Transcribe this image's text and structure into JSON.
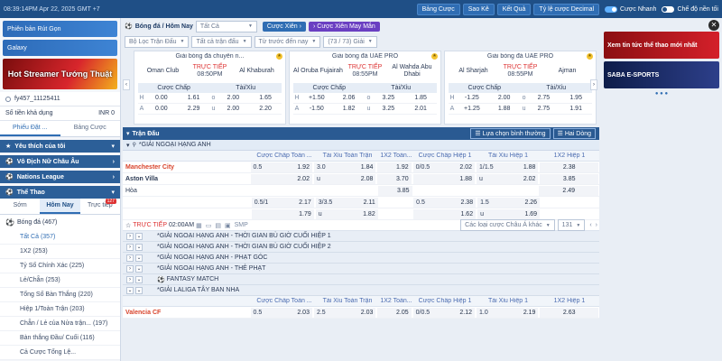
{
  "topbar": {
    "time": "08:39:14PM Apr 22, 2025 GMT +7",
    "buttons": [
      "Bảng Cược",
      "Sao Kê",
      "Kết Quả",
      "Tỷ lệ cược Decimal"
    ],
    "toggle_fast": "Cược Nhanh",
    "toggle_bg": "Chế độ nền tối"
  },
  "sidebar": {
    "promo1": "Phiên bản Rút Gọn",
    "promo2": "Galaxy",
    "banner": "Hot Streamer Tướng Thuật",
    "user": "fy457_11125411",
    "balance_label": "Số tiền khả dụng",
    "balance_value": "INR 0",
    "tabs": [
      "Phiếu Đặt ...",
      "Bảng Cược"
    ],
    "sections": [
      "Yêu thích của tôi",
      "Vô Địch Nữ Châu Âu",
      "Nations League",
      "Thể Thao"
    ],
    "subtabs": [
      "Sớm",
      "Hôm Nay",
      "Trực tiếp"
    ],
    "subtab_count": "127",
    "sport": "Bóng đá",
    "sport_count": "(467)",
    "list": [
      "Tất Cả (357)",
      "1X2 (253)",
      "Tỷ Số Chính Xác (225)",
      "Lẻ/Chẵn (253)",
      "Tổng Số Bàn Thắng (220)",
      "Hiệp 1/Toàn Trận (203)",
      "Chẵn / Lẻ của Nửa trận... (197)",
      "Bàn thắng Đầu/ Cuối (116)",
      "Cả Cược Tổng Lệ..."
    ]
  },
  "filters": {
    "sport_label": "Bóng đá / Hôm Nay",
    "all": "Tất Cả",
    "bet": "Cược Xiên",
    "bet_lucky": "Cược Xiên May Mắn",
    "league_filter": "Bộ Lọc Trận Đấu",
    "all_matches": "Tất cả trận đấu",
    "before": "Từ trước đến nay",
    "count": "(73 / 73) Giải"
  },
  "cards": [
    {
      "league": "Giải bóng đá chuyên n...",
      "home": "Oman Club",
      "away": "Al Khaburah",
      "live": "TRỰC TIẾP",
      "time": "08:50PM",
      "h": [
        "H",
        "0.00",
        "1.61",
        "o",
        "2.00",
        "1.65"
      ],
      "a": [
        "A",
        "0.00",
        "2.29",
        "u",
        "2.00",
        "2.20"
      ]
    },
    {
      "league": "Giải bóng đá UAE PRO",
      "home": "Al Oruba Fujairah",
      "away": "Al Wahda Abu Dhabi",
      "live": "TRỰC TIẾP",
      "time": "08:55PM",
      "h": [
        "H",
        "+1.50",
        "2.06",
        "o",
        "3.25",
        "1.85"
      ],
      "a": [
        "A",
        "-1.50",
        "1.82",
        "u",
        "3.25",
        "2.01"
      ]
    },
    {
      "league": "Giải bóng đá UAE PRO",
      "home": "Al Sharjah",
      "away": "Ajman",
      "live": "TRỰC TIẾP",
      "time": "08:55PM",
      "h": [
        "H",
        "-1.25",
        "2.00",
        "o",
        "2.75",
        "1.95"
      ],
      "a": [
        "A",
        "+1.25",
        "1.88",
        "u",
        "2.75",
        "1.91"
      ]
    }
  ],
  "card_heads": [
    "Cược Chấp",
    "Tài/Xỉu"
  ],
  "table": {
    "title": "Trận Đấu",
    "sort": "Lựa chọn bình thường",
    "lines": "Hai Dòng",
    "league1": "*GIẢI NGOẠI HẠNG ANH",
    "cols": [
      "Cược Chấp Toàn ...",
      "Tài Xỉu Toàn Trận",
      "1X2 Toàn...",
      "Cược Chấp Hiệp 1",
      "Tài Xỉu Hiệp 1",
      "1X2 Hiệp 1"
    ],
    "home": "Manchester City",
    "away": "Aston Villa",
    "draw": "Hòa",
    "row1": [
      "0.5",
      "1.92",
      "3.0",
      "1.84",
      "1.92",
      "0/0.5",
      "2.02",
      "1/1.5",
      "1.88",
      "2.38"
    ],
    "row2": [
      "",
      "2.02",
      "u",
      "2.08",
      "3.70",
      "",
      "1.88",
      "u",
      "2.02",
      "3.85"
    ],
    "row3": [
      "3.85",
      "2.49"
    ],
    "row4": [
      "0.5/1",
      "2.17",
      "3/3.5",
      "2.11",
      "0.5",
      "2.38",
      "1.5",
      "2.26"
    ],
    "row5": [
      "",
      "1.79",
      "u",
      "1.82",
      "",
      "1.62",
      "u",
      "1.69"
    ],
    "live": "TRỰC TIẾP",
    "live_time": "02:00AM",
    "smp": "SMP",
    "other_types": "Các loại cược Châu Á khác",
    "other_count": "131",
    "sub_leagues": [
      "*GIẢI NGOẠI HẠNG ANH - THỜI GIAN BÙ GIỜ CUỐI HIỆP 1",
      "*GIẢI NGOẠI HẠNG ANH - THỜI GIAN BÙ GIỜ CUỐI HIỆP 2",
      "*GIẢI NGOẠI HẠNG ANH - PHẠT GÓC",
      "*GIẢI NGOẠI HẠNG ANH - THẺ PHẠT",
      "FANTASY MATCH",
      "*GIẢI LALIGA TÂY BAN NHA"
    ],
    "home2": "Valencia CF",
    "row6": [
      "0.5",
      "2.03",
      "2.5",
      "2.03",
      "2.05",
      "0/0.5",
      "2.12",
      "1.0",
      "2.19",
      "2.63"
    ]
  },
  "right": {
    "ad1": "Xem tin tức thể thao mới nhất",
    "ad2": "SABA E-SPORTS",
    "dots": "● ● ●"
  }
}
